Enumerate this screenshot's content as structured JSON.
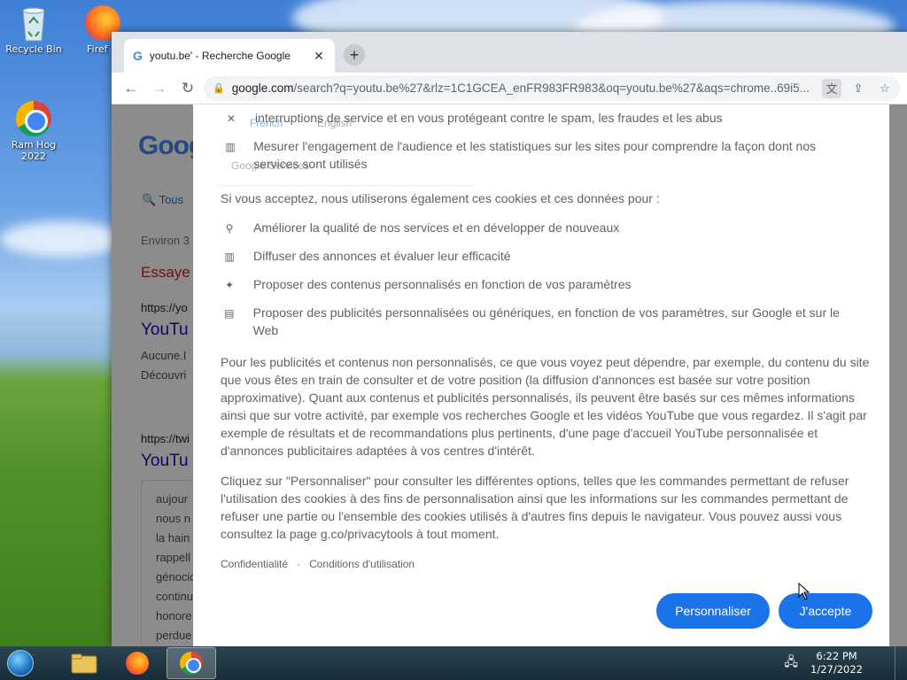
{
  "desktop": {
    "icons": [
      {
        "label": "Recycle Bin",
        "icon": "recycle-bin-icon"
      },
      {
        "label": "Firef",
        "icon": "firefox-icon"
      },
      {
        "label": "Ram Hog\n2022",
        "icon": "chrome-icon"
      }
    ]
  },
  "browser": {
    "tab_title": "youtu.be' - Recherche Google",
    "url_host": "google.com",
    "url_rest": "/search?q=youtu.be%27&rlz=1C1GCEA_enFR983FR983&oq=youtu.be%27&aqs=chrome..69i5..."
  },
  "background_page": {
    "logo": "Goog",
    "tab_all": "Tous",
    "results_count": "Environ 3",
    "try_text": "Essaye",
    "result1_url": "https://yo",
    "result1_title": "YouTu",
    "result1_desc1": "Aucune.I",
    "result1_desc2": "Découvri",
    "result2_url": "https://twi",
    "result2_title": "YouTu",
    "snippet_lines": [
      "aujour",
      "nous n",
      "la hain",
      "rappell",
      "génocid",
      "continu",
      "honore",
      "perdue"
    ],
    "lang_french": "French",
    "lang_english": "English",
    "google_services": "Google Services"
  },
  "consent": {
    "top_bullets": [
      {
        "icon": "close-icon",
        "text": "interruptions de service et en vous protégeant contre le spam, les fraudes et les abus"
      },
      {
        "icon": "chart-icon",
        "text": "Mesurer l'engagement de l'audience et les statistiques sur les sites pour comprendre la façon dont nos services sont utilisés"
      }
    ],
    "intro": "Si vous acceptez, nous utiliserons également ces cookies et ces données pour :",
    "bullets": [
      {
        "icon": "search-icon",
        "text": "Améliorer la qualité de nos services et en développer de nouveaux"
      },
      {
        "icon": "chart-icon",
        "text": "Diffuser des annonces et évaluer leur efficacité"
      },
      {
        "icon": "sparkle-icon",
        "text": "Proposer des contenus personnalisés en fonction de vos paramètres"
      },
      {
        "icon": "ad-icon",
        "text": "Proposer des publicités personnalisées ou génériques, en fonction de vos paramètres, sur Google et sur le Web"
      }
    ],
    "paragraph1": "Pour les publicités et contenus non personnalisés, ce que vous voyez peut dépendre, par exemple, du contenu du site que vous êtes en train de consulter et de votre position (la diffusion d'annonces est basée sur votre position approximative). Quant aux contenus et publicités personnalisés, ils peuvent être basés sur ces mêmes informations ainsi que sur votre activité, par exemple vos recherches Google et les vidéos YouTube que vous regardez. Il s'agit par exemple de résultats et de recommandations plus pertinents, d'une page d'accueil YouTube personnalisée et d'annonces publicitaires adaptées à vos centres d'intérêt.",
    "paragraph2": "Cliquez sur \"Personnaliser\" pour consulter les différentes options, telles que les commandes permettant de refuser l'utilisation des cookies à des fins de personnalisation ainsi que les informations sur les commandes permettant de refuser une partie ou l'ensemble des cookies utilisés à d'autres fins depuis le navigateur. Vous pouvez aussi vous consultez la page g.co/privacytools à tout moment.",
    "link_privacy": "Confidentialité",
    "link_separator": "·",
    "link_terms": "Conditions d'utilisation",
    "btn_customize": "Personnaliser",
    "btn_accept": "J'accepte"
  },
  "taskbar": {
    "time": "6:22 PM",
    "date": "1/27/2022"
  }
}
